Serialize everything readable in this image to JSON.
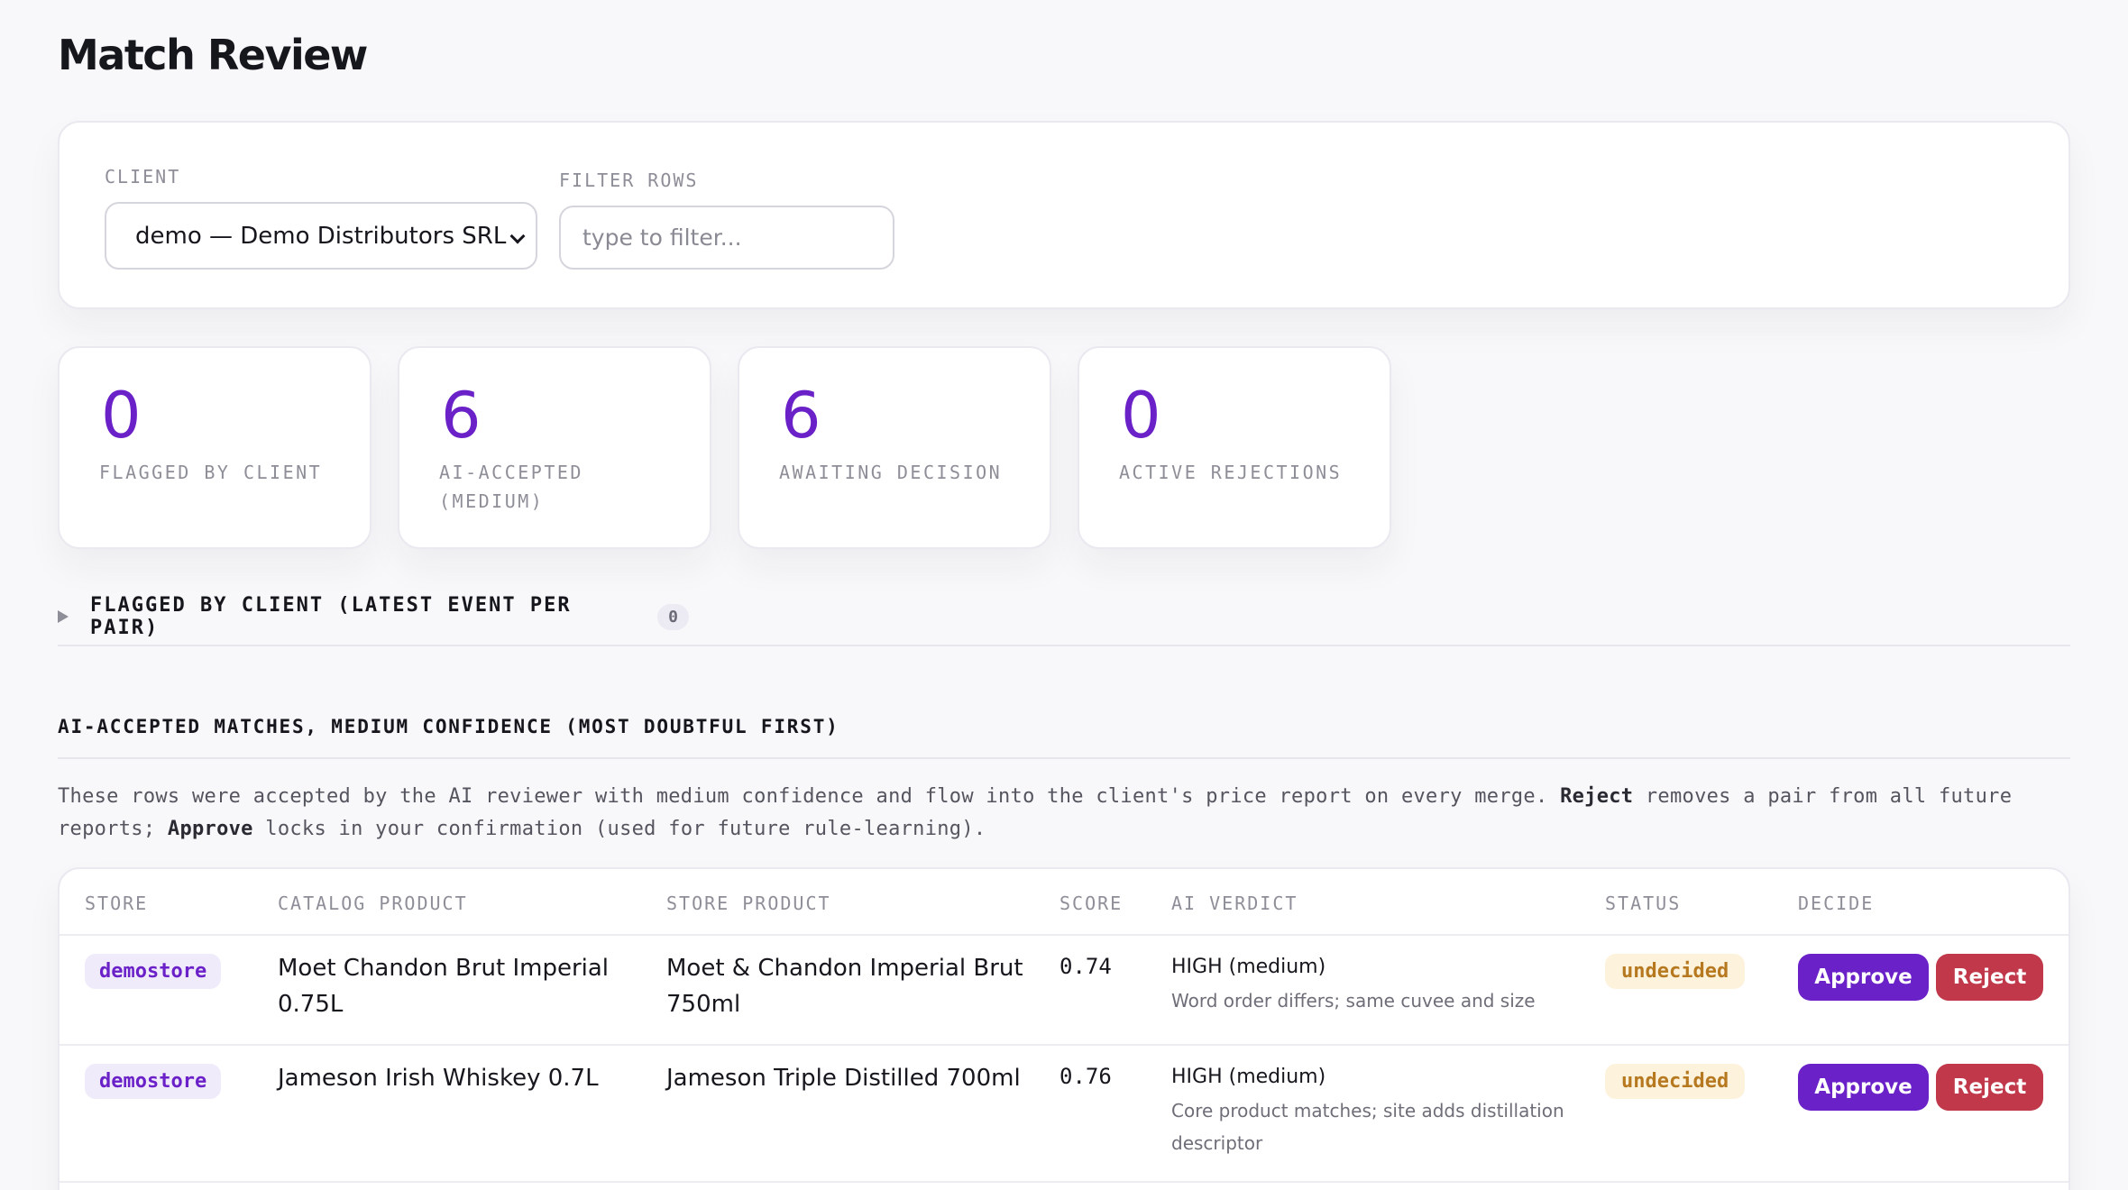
{
  "page": {
    "title": "Match Review"
  },
  "filters": {
    "client_label": "CLIENT",
    "client_value": "demo — Demo Distributors SRL",
    "filter_label": "FILTER ROWS",
    "filter_placeholder": "type to filter...",
    "filter_value": ""
  },
  "stats": [
    {
      "value": "0",
      "label": "FLAGGED BY CLIENT"
    },
    {
      "value": "6",
      "label": "AI-ACCEPTED (MEDIUM)"
    },
    {
      "value": "6",
      "label": "AWAITING DECISION"
    },
    {
      "value": "0",
      "label": "ACTIVE REJECTIONS"
    }
  ],
  "flagged_section": {
    "title": "FLAGGED BY CLIENT (LATEST EVENT PER PAIR)",
    "count": "0"
  },
  "ai_section": {
    "title": "AI-ACCEPTED MATCHES, MEDIUM CONFIDENCE (MOST DOUBTFUL FIRST)",
    "desc_part1": "These rows were accepted by the AI reviewer with medium confidence and flow into the client's price report on every merge. ",
    "desc_reject": "Reject",
    "desc_part2": " removes a pair from all future reports; ",
    "desc_approve": "Approve",
    "desc_part3": " locks in your confirmation (used for future rule-learning)."
  },
  "table": {
    "headers": {
      "store": "STORE",
      "catalog": "CATALOG PRODUCT",
      "store_product": "STORE PRODUCT",
      "score": "SCORE",
      "verdict": "AI VERDICT",
      "status": "STATUS",
      "decide": "DECIDE"
    },
    "rows": [
      {
        "store": "demostore",
        "catalog_product": "Moet Chandon Brut Imperial 0.75L",
        "store_product": "Moet & Chandon Imperial Brut 750ml",
        "score": "0.74",
        "verdict": "HIGH (medium)",
        "reason": "Word order differs; same cuvee and size",
        "status": "undecided",
        "approve": "Approve",
        "reject": "Reject"
      },
      {
        "store": "demostore",
        "catalog_product": "Jameson Irish Whiskey 0.7L",
        "store_product": "Jameson Triple Distilled 700ml",
        "score": "0.76",
        "verdict": "HIGH (medium)",
        "reason": "Core product matches; site adds distillation descriptor",
        "status": "undecided",
        "approve": "Approve",
        "reject": "Reject"
      }
    ]
  },
  "colors": {
    "accent": "#6b21c8",
    "reject": "#c0384a",
    "status_undecided_bg": "#fdf2dc",
    "status_undecided_text": "#b7791f"
  }
}
